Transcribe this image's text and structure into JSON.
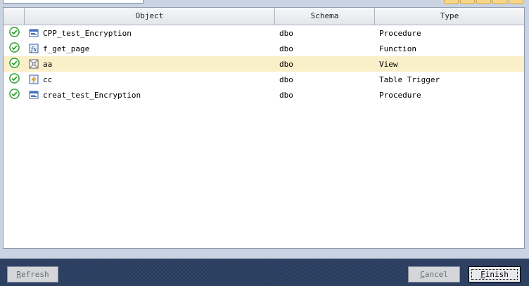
{
  "columns": {
    "object": "Object",
    "schema": "Schema",
    "type": "Type"
  },
  "rows": [
    {
      "icon": "procedure-icon",
      "name": "CPP_test_Encryption",
      "schema": "dbo",
      "type": "Procedure",
      "selected": false
    },
    {
      "icon": "function-icon",
      "name": "f_get_page",
      "schema": "dbo",
      "type": "Function",
      "selected": false
    },
    {
      "icon": "view-icon",
      "name": "aa",
      "schema": "dbo",
      "type": "View",
      "selected": true
    },
    {
      "icon": "trigger-icon",
      "name": "cc",
      "schema": "dbo",
      "type": "Table Trigger",
      "selected": false
    },
    {
      "icon": "procedure-icon",
      "name": "creat_test_Encryption",
      "schema": "dbo",
      "type": "Procedure",
      "selected": false
    }
  ],
  "buttons": {
    "refresh": {
      "mnemonic": "R",
      "rest": "efresh"
    },
    "cancel": {
      "mnemonic": "C",
      "rest": "ancel"
    },
    "finish": {
      "mnemonic": "F",
      "rest": "inish"
    }
  },
  "colors": {
    "selected_row": "#fbefc9",
    "status_ok": "#2e9d2e",
    "footer": "#2a3f63"
  }
}
